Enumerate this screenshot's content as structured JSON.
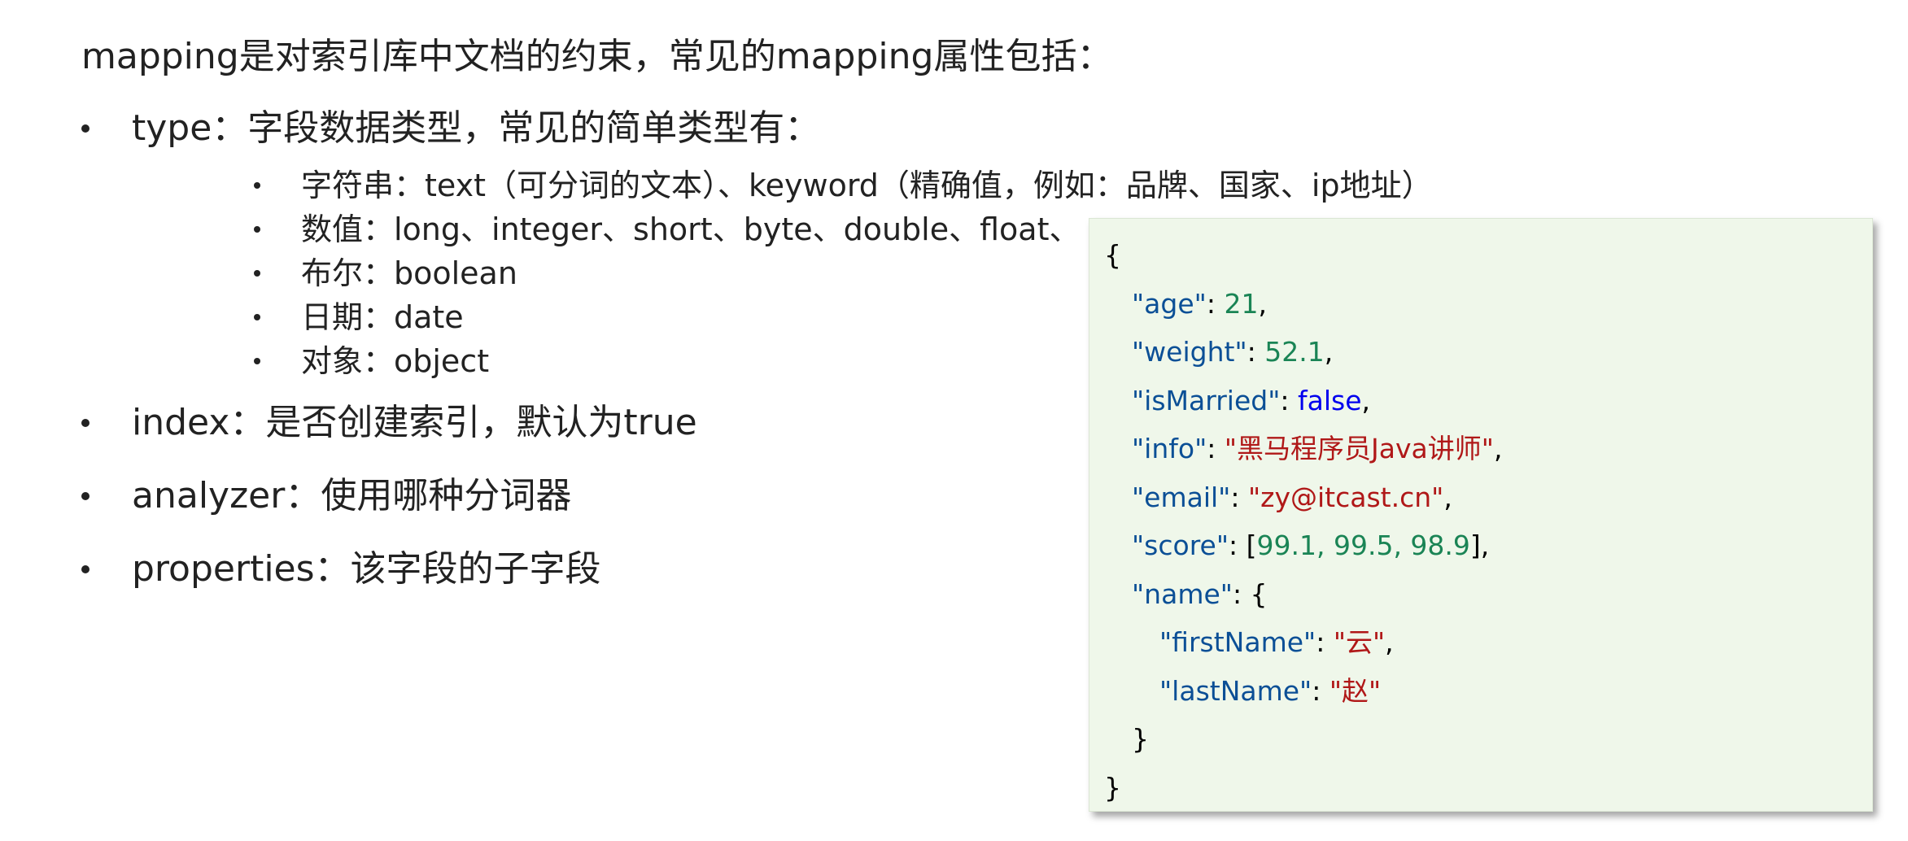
{
  "heading": "mapping是对索引库中文档的约束，常见的mapping属性包括：",
  "list": {
    "type_item": "type：字段数据类型，常见的简单类型有：",
    "sub_items": [
      "字符串：text（可分词的文本）、keyword（精确值，例如：品牌、国家、ip地址）",
      "数值：long、integer、short、byte、double、float、",
      "布尔：boolean",
      "日期：date",
      "对象：object"
    ],
    "index_item": "index：是否创建索引，默认为true",
    "analyzer_item": "analyzer：使用哪种分词器",
    "properties_item": "properties：该字段的子字段"
  },
  "code": {
    "open_brace": "{",
    "close_brace": "}",
    "inner_close": "}",
    "age_key": "\"age\"",
    "age_value": "21",
    "weight_key": "\"weight\"",
    "weight_value": "52.1",
    "married_key": "\"isMarried\"",
    "married_value": "false",
    "info_key": "\"info\"",
    "info_value": "\"黑马程序员Java讲师\"",
    "email_key": "\"email\"",
    "email_value": "\"zy@itcast.cn\"",
    "score_key": "\"score\"",
    "score_values": "99.1, 99.5, 98.9",
    "name_key": "\"name\"",
    "first_key": "\"firstName\"",
    "first_value": "\"云\"",
    "last_key": "\"lastName\"",
    "last_value": "\"赵\""
  },
  "colors": {
    "key": "#0b4f96",
    "number": "#1a8455",
    "boolean": "#0000ee",
    "string": "#b01818",
    "code_background": "#eff7ea"
  }
}
